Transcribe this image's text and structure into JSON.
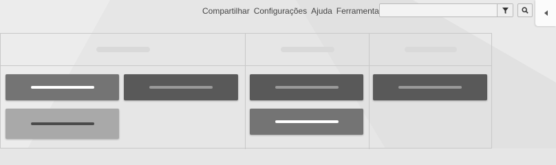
{
  "topnav": {
    "links": [
      "Compartilhar",
      "Configurações",
      "Ajuda",
      "Ferramentas"
    ]
  },
  "search": {
    "value": "",
    "placeholder": ""
  },
  "icons": {
    "filter": "funnel-icon",
    "search": "magnifier-icon",
    "panel_toggle": "chevron-left-icon"
  },
  "colors": {
    "card_dark": "#595959",
    "card_mid": "#747474",
    "card_light": "#a9a9a9",
    "placeholder_white": "#ffffff",
    "placeholder_gray": "#9a9a9a",
    "placeholder_dark": "#4a4a4a"
  }
}
